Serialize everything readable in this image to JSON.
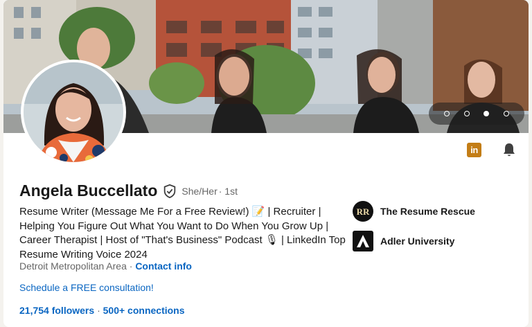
{
  "profile": {
    "name": "Angela Buccellato",
    "pronouns": "She/Her",
    "degree": "· 1st",
    "headline": "Resume Writer (Message Me For a Free Review!) 📝 | Recruiter | Helping You Figure Out What You Want to Do When You Grow Up | Career Therapist | Host of \"That's Business\" Podcast 🎙 | LinkedIn Top Resume Writing Voice 2024",
    "location": "Detroit Metropolitan Area",
    "location_sep": "·",
    "contact_label": "Contact info",
    "schedule_link": "Schedule a FREE consultation!",
    "followers": "21,754 followers",
    "stats_sep": "·",
    "connections": "500+ connections"
  },
  "orgs": [
    {
      "name": "The Resume Rescue",
      "logo_text": "RR",
      "icon": "resume-rescue-logo"
    },
    {
      "name": "Adler University",
      "logo_text": "A",
      "icon": "adler-university-logo"
    }
  ],
  "cover": {
    "carousel_count": 4,
    "carousel_active": 3
  },
  "icons": {
    "linkedin_badge_text": "in",
    "linkedin": "linkedin-icon",
    "bell": "bell-icon",
    "verified": "verified-shield-icon"
  },
  "colors": {
    "link": "#0a66c2",
    "badge": "#c37d16",
    "text": "#191919",
    "muted": "#666666"
  }
}
